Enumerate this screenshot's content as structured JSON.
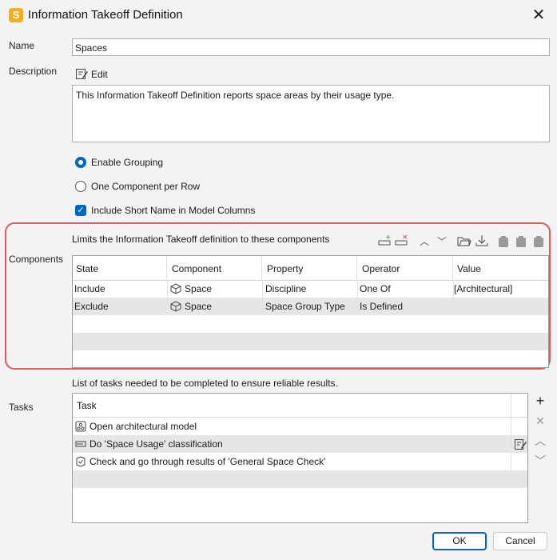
{
  "window": {
    "title": "Information Takeoff Definition",
    "app_icon_letter": "S",
    "close_glyph": "✕"
  },
  "name": {
    "label": "Name",
    "value": "Spaces"
  },
  "description": {
    "label": "Description",
    "edit_label": "Edit",
    "text": "This Information Takeoff Definition reports space areas by their usage type."
  },
  "options": {
    "enable_grouping": "Enable Grouping",
    "one_component_per_row": "One Component per Row",
    "include_short_name": "Include Short Name in Model Columns",
    "grouping_selected": true,
    "short_name_checked": true
  },
  "components": {
    "label": "Components",
    "hint": "Limits the Information Takeoff definition to these components",
    "columns": [
      "State",
      "Component",
      "Property",
      "Operator",
      "Value"
    ],
    "rows": [
      {
        "state": "Include",
        "component": "Space",
        "property": "Discipline",
        "operator": "One Of",
        "value": "[Architectural]"
      },
      {
        "state": "Exclude",
        "component": "Space",
        "property": "Space Group Type",
        "operator": "Is Defined",
        "value": ""
      }
    ]
  },
  "tasks": {
    "label": "Tasks",
    "hint": "List of tasks needed to be completed to ensure reliable results.",
    "column": "Task",
    "rows": [
      {
        "text": "Open architectural model",
        "icon": "model-icon"
      },
      {
        "text": "Do 'Space Usage' classification",
        "icon": "classification-icon"
      },
      {
        "text": "Check and go through results of 'General Space Check'",
        "icon": "check-icon"
      }
    ]
  },
  "buttons": {
    "ok": "OK",
    "cancel": "Cancel"
  },
  "colors": {
    "accent": "#0067c0",
    "highlight_box": "#e05a5a",
    "app_icon": "#f2b01e"
  }
}
